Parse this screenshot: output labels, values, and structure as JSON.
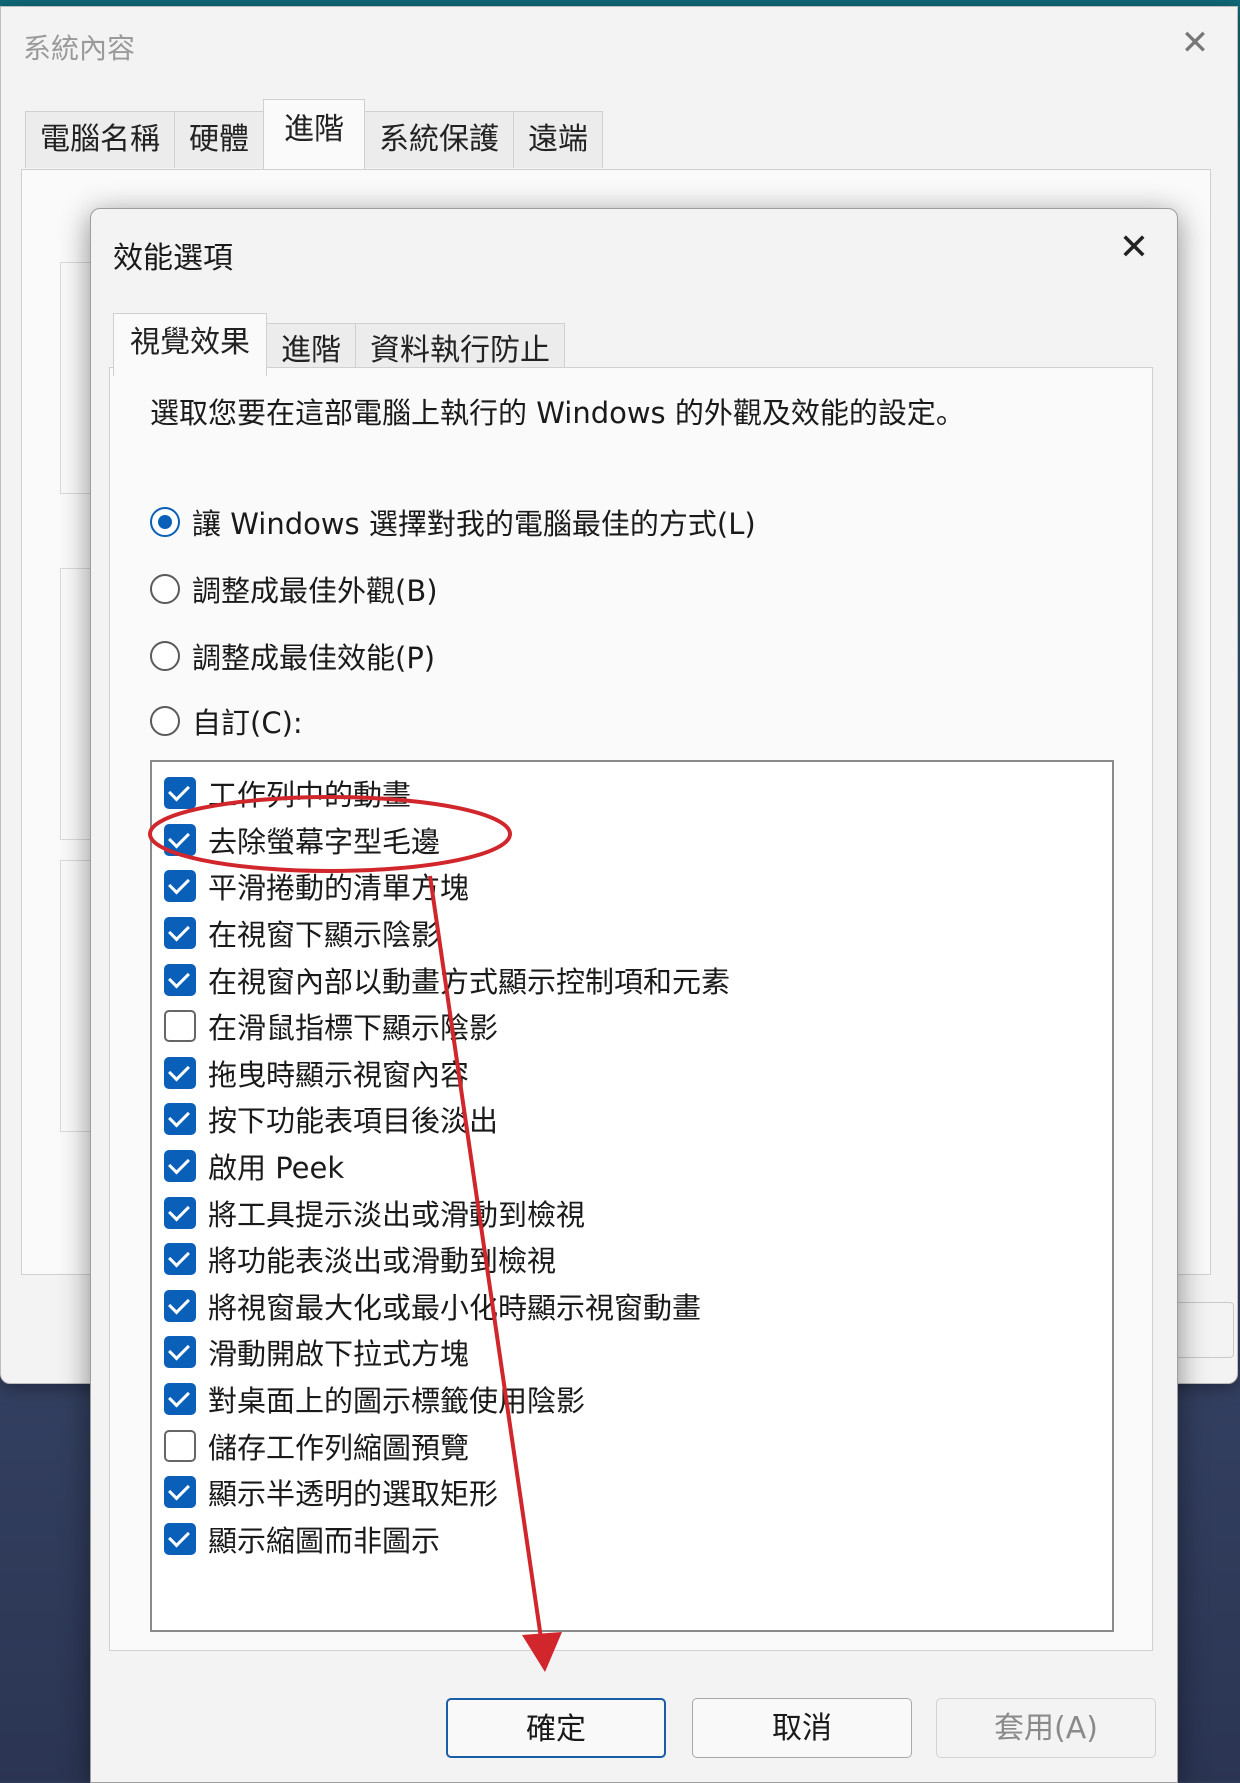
{
  "system_properties": {
    "title": "系統內容",
    "tabs": [
      "電腦名稱",
      "硬體",
      "進階",
      "系統保護",
      "遠端"
    ],
    "active_tab": 2
  },
  "performance_options": {
    "title": "效能選項",
    "tabs": [
      "視覺效果",
      "進階",
      "資料執行防止"
    ],
    "active_tab": 0,
    "description": "選取您要在這部電腦上執行的 Windows 的外觀及效能的設定。",
    "radios": [
      {
        "label": "讓 Windows 選擇對我的電腦最佳的方式(L)",
        "selected": true
      },
      {
        "label": "調整成最佳外觀(B)",
        "selected": false
      },
      {
        "label": "調整成最佳效能(P)",
        "selected": false
      },
      {
        "label": "自訂(C):",
        "selected": false
      }
    ],
    "checkboxes": [
      {
        "label": "工作列中的動畫",
        "checked": true
      },
      {
        "label": "去除螢幕字型毛邊",
        "checked": true
      },
      {
        "label": "平滑捲動的清單方塊",
        "checked": true
      },
      {
        "label": "在視窗下顯示陰影",
        "checked": true
      },
      {
        "label": "在視窗內部以動畫方式顯示控制項和元素",
        "checked": true
      },
      {
        "label": "在滑鼠指標下顯示陰影",
        "checked": false
      },
      {
        "label": "拖曳時顯示視窗內容",
        "checked": true
      },
      {
        "label": "按下功能表項目後淡出",
        "checked": true
      },
      {
        "label": "啟用 Peek",
        "checked": true
      },
      {
        "label": "將工具提示淡出或滑動到檢視",
        "checked": true
      },
      {
        "label": "將功能表淡出或滑動到檢視",
        "checked": true
      },
      {
        "label": "將視窗最大化或最小化時顯示視窗動畫",
        "checked": true
      },
      {
        "label": "滑動開啟下拉式方塊",
        "checked": true
      },
      {
        "label": "對桌面上的圖示標籤使用陰影",
        "checked": true
      },
      {
        "label": "儲存工作列縮圖預覽",
        "checked": false
      },
      {
        "label": "顯示半透明的選取矩形",
        "checked": true
      },
      {
        "label": "顯示縮圖而非圖示",
        "checked": true
      }
    ],
    "buttons": {
      "ok": "確定",
      "cancel": "取消",
      "apply": "套用(A)"
    }
  },
  "colors": {
    "accent": "#0a5fb8",
    "annotation": "#d0262c"
  }
}
